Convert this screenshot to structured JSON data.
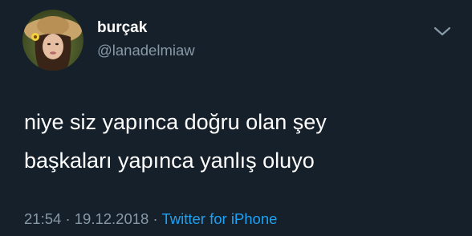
{
  "tweet": {
    "author": {
      "display_name": "burçak",
      "handle": "@lanadelmiaw",
      "avatar_icon": "profile-photo"
    },
    "menu_icon": "chevron-down-icon",
    "text_lines": [
      "niye siz yapınca doğru olan şey",
      "başkaları yapınca yanlış oluyo"
    ],
    "meta": {
      "time": "21:54",
      "separator": "·",
      "date": "19.12.2018",
      "source": "Twitter for iPhone"
    }
  },
  "colors": {
    "background": "#15202b",
    "primary_text": "#ffffff",
    "secondary_text": "#8899a6",
    "link": "#1da1f2"
  }
}
